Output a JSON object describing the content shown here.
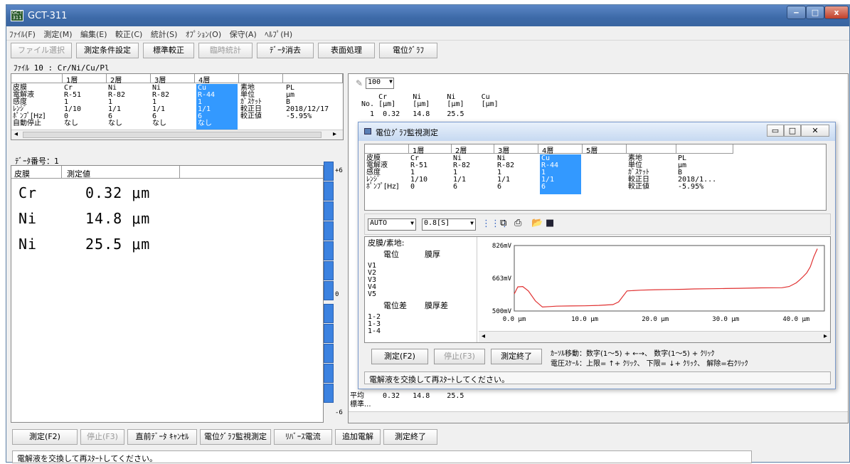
{
  "window": {
    "title": "GCT-311",
    "icon": "gct-app-icon",
    "min": "‒",
    "max": "□",
    "close": "x"
  },
  "menu": [
    "ﾌｧｲﾙ(F)",
    "測定(M)",
    "編集(E)",
    "較正(C)",
    "統計(S)",
    "ｵﾌﾟｼｮﾝ(O)",
    "保守(A)",
    "ﾍﾙﾌﾟ(H)"
  ],
  "toolbar": [
    "ファイル選択",
    "測定条件設定",
    "標準較正",
    "臨時統計",
    "ﾃﾞｰﾀ消去",
    "表面処理",
    "電位ｸﾞﾗﾌ"
  ],
  "file_line": "ﾌｧｲﾙ  10 : Cr/Ni/Cu/Pl",
  "layers": {
    "headers": [
      "1層",
      "2層",
      "3層",
      "4層"
    ],
    "row_labels": [
      "皮膜",
      "電解液",
      "感度",
      "ﾚﾝｼﾞ",
      "ﾎﾟﾝﾌﾟ[Hz]",
      "自動停止"
    ],
    "columns": [
      [
        "Cr",
        "R-51",
        "1",
        "1/10",
        "0",
        "なし"
      ],
      [
        "Ni",
        "R-82",
        "1",
        "1/1",
        "6",
        "なし"
      ],
      [
        "Ni",
        "R-82",
        "1",
        "1/1",
        "6",
        "なし"
      ],
      [
        "Cu",
        "R-44",
        "1",
        "1/1",
        "6",
        "なし"
      ]
    ],
    "right_labels": [
      "素地",
      "単位",
      "ｶﾞｽｹｯﾄ",
      "較正日",
      "較正値"
    ],
    "right_values": [
      "PL",
      "μm",
      "B",
      "2018/12/17",
      "-5.95%"
    ]
  },
  "data_number": "ﾃﾞｰﾀ番号：1",
  "result": {
    "col1": "皮膜",
    "col2": "測定値",
    "rows": [
      {
        "name": "Cr",
        "value": "0.32  μm"
      },
      {
        "name": "Ni",
        "value": "14.8  μm"
      },
      {
        "name": "Ni",
        "value": "25.5  μm"
      }
    ]
  },
  "scale": {
    "top": "+6",
    "mid": "0",
    "bottom": "-6"
  },
  "history": {
    "zoom": "100",
    "header": "    Cr      Ni      Ni      Cu",
    "header2": "No. [μm]    [μm]    [μm]    [μm]",
    "row1": "  1  0.32   14.8    25.5",
    "avg_label": "平均",
    "avg": "0.32   14.8    25.5",
    "std_label": "標準..."
  },
  "dialog": {
    "title": "電位ｸﾞﾗﾌ監視測定",
    "headers": [
      "1層",
      "2層",
      "3層",
      "4層",
      "5層"
    ],
    "row_labels": [
      "皮膜",
      "電解液",
      "感度",
      "ﾚﾝｼﾞ",
      "ﾎﾟﾝﾌﾟ[Hz]"
    ],
    "columns": [
      [
        "Cr",
        "R-51",
        "1",
        "1/10",
        "0"
      ],
      [
        "Ni",
        "R-82",
        "1",
        "1/1",
        "6"
      ],
      [
        "Ni",
        "R-82",
        "1",
        "1/1",
        "6"
      ],
      [
        "Cu",
        "R-44",
        "1",
        "1/1",
        "6"
      ]
    ],
    "right_labels": [
      "素地",
      "単位",
      "ｶﾞｽｹｯﾄ",
      "較正日",
      "較正値"
    ],
    "right_values": [
      "PL",
      "μm",
      "B",
      "2018/1...",
      "-5.95%"
    ],
    "auto": "AUTO",
    "interval": "0.8[S]",
    "left": {
      "title": "皮膜/素地:",
      "h1": "電位",
      "h2": "膜厚",
      "v": [
        "V1",
        "V2",
        "V3",
        "V4",
        "V5"
      ],
      "h3": "電位差",
      "h4": "膜厚差",
      "d": [
        "1-2",
        "1-3",
        "1-4"
      ]
    },
    "buttons": [
      "測定(F2)",
      "停止(F3)",
      "測定終了"
    ],
    "help1": "ｶｰｿﾙ移動：数字(1～5) + ←→、 数字(1～5) + ｸﾘｯｸ",
    "help2": "電圧ｽｹｰﾙ：上限= ↑+ ｸﾘｯｸ、 下限= ↓+ ｸﾘｯｸ、 解除=右ｸﾘｯｸ",
    "status": "電解液を交換して再ｽﾀｰﾄしてください。"
  },
  "chart_data": {
    "type": "line",
    "x_ticks": [
      "0.0 μm",
      "10.0 μm",
      "20.0 μm",
      "30.0 μm",
      "40.0 μm"
    ],
    "y_ticks": [
      "826mV",
      "663mV",
      "500mV"
    ],
    "ylim": [
      500,
      826
    ],
    "xlim": [
      0,
      44
    ],
    "color": "#e03030",
    "x": [
      0,
      0.5,
      1.2,
      2,
      3,
      4,
      5,
      6,
      8,
      10,
      12,
      14,
      14.8,
      16,
      18,
      20,
      22,
      24,
      25.5,
      28,
      30,
      32,
      35,
      38,
      39,
      40,
      40.5,
      41,
      41.5,
      42,
      42.5,
      43
    ],
    "values": [
      585,
      620,
      622,
      600,
      550,
      520,
      522,
      524,
      525,
      526,
      528,
      532,
      545,
      600,
      604,
      606,
      607,
      608,
      610,
      611,
      612,
      613,
      615,
      616,
      622,
      640,
      655,
      672,
      690,
      720,
      770,
      810
    ]
  },
  "bottom_buttons": [
    "測定(F2)",
    "停止(F3)",
    "直前ﾃﾞｰﾀ ｷｬﾝｾﾙ",
    "電位ｸﾞﾗﾌ監視測定",
    "ﾘﾊﾞｰｽ電流",
    "追加電解",
    "測定終了"
  ],
  "status": "電解液を交換して再ｽﾀｰﾄしてください。"
}
